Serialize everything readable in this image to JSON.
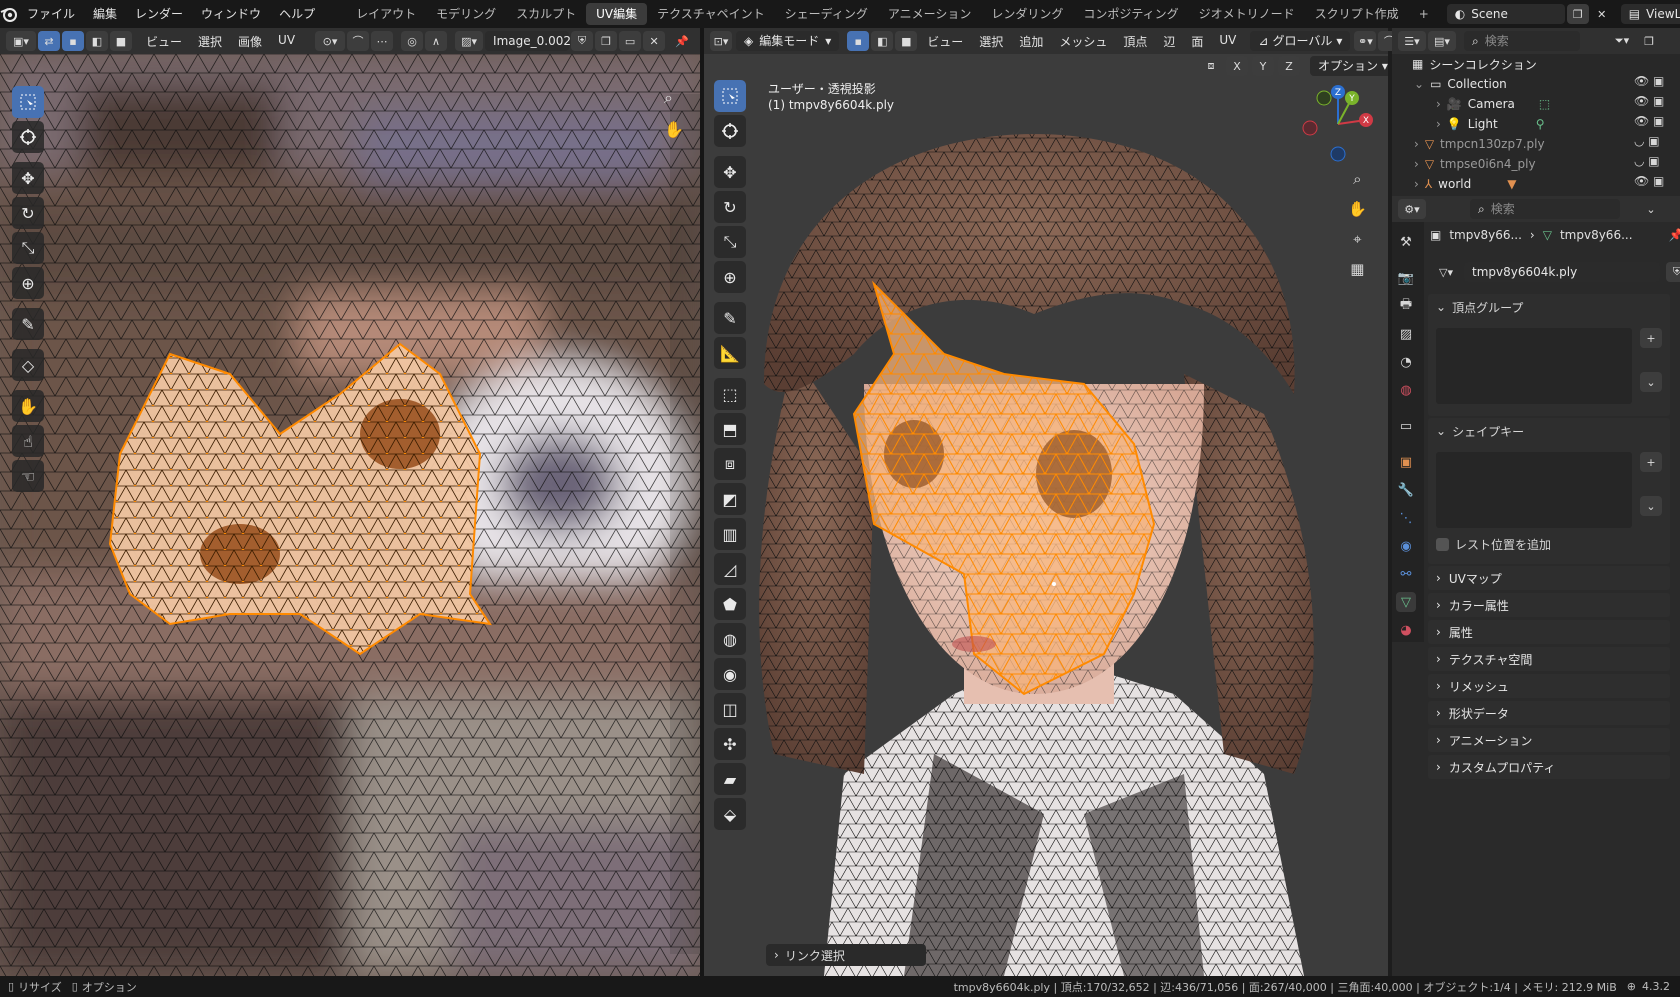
{
  "app": {
    "menus": [
      "ファイル",
      "編集",
      "レンダー",
      "ウィンドウ",
      "ヘルプ"
    ],
    "workspace_tabs": [
      "レイアウト",
      "モデリング",
      "スカルプト",
      "UV編集",
      "テクスチャペイント",
      "シェーディング",
      "アニメーション",
      "レンダリング",
      "コンポジティング",
      "ジオメトリノード",
      "スクリプト作成"
    ],
    "active_workspace": "UV編集",
    "add_tab": "+",
    "scene_name": "Scene",
    "view_layer": "ViewLayer"
  },
  "uv_editor": {
    "menus": [
      "ビュー",
      "選択",
      "画像",
      "UV"
    ],
    "image_name": "Image_0.002"
  },
  "viewport": {
    "mode": "編集モード",
    "menus": [
      "ビュー",
      "選択",
      "追加",
      "メッシュ",
      "頂点",
      "辺",
      "面",
      "UV"
    ],
    "transform_orientation": "グローバル",
    "axes": [
      "X",
      "Y",
      "Z"
    ],
    "options_label": "オプション",
    "view_title": "ユーザー・透視投影",
    "object_label": "(1) tmpv8y6604k.ply",
    "gizmo_axes": {
      "x": "X",
      "y": "Y",
      "z": "Z"
    },
    "last_op": "リンク選択"
  },
  "outliner": {
    "search_placeholder": "検索",
    "root": "シーンコレクション",
    "items": [
      {
        "label": "Collection",
        "level": 1
      },
      {
        "label": "Camera",
        "level": 2
      },
      {
        "label": "Light",
        "level": 2
      },
      {
        "label": "tmpcn130zp7.ply",
        "level": 1
      },
      {
        "label": "tmpse0i6n4_ply",
        "level": 1
      },
      {
        "label": "world",
        "level": 1
      }
    ]
  },
  "properties": {
    "search_placeholder": "検索",
    "breadcrumb_obj": "tmpv8y66...",
    "breadcrumb_mesh": "tmpv8y66...",
    "mesh_name": "tmpv8y6604k.ply",
    "vertex_groups": "頂点グループ",
    "shape_keys": "シェイプキー",
    "relative_checkbox": "レスト位置を追加",
    "sections": [
      "UVマップ",
      "カラー属性",
      "属性",
      "テクスチャ空間",
      "リメッシュ",
      "形状データ",
      "アニメーション",
      "カスタムプロパティ"
    ]
  },
  "status": {
    "left1": "リサイズ",
    "left2": "オプション",
    "right": "tmpv8y6604k.ply | 頂点:170/32,652 | 辺:436/71,056 | 面:267/40,000 | 三角面:40,000 | オブジェクト:1/4 | メモリ: 212.9 MiB",
    "version": "4.3.2"
  },
  "colors": {
    "accent": "#4772b3",
    "selection": "#ff8a00",
    "topbar": "#181818",
    "header": "#303030"
  }
}
